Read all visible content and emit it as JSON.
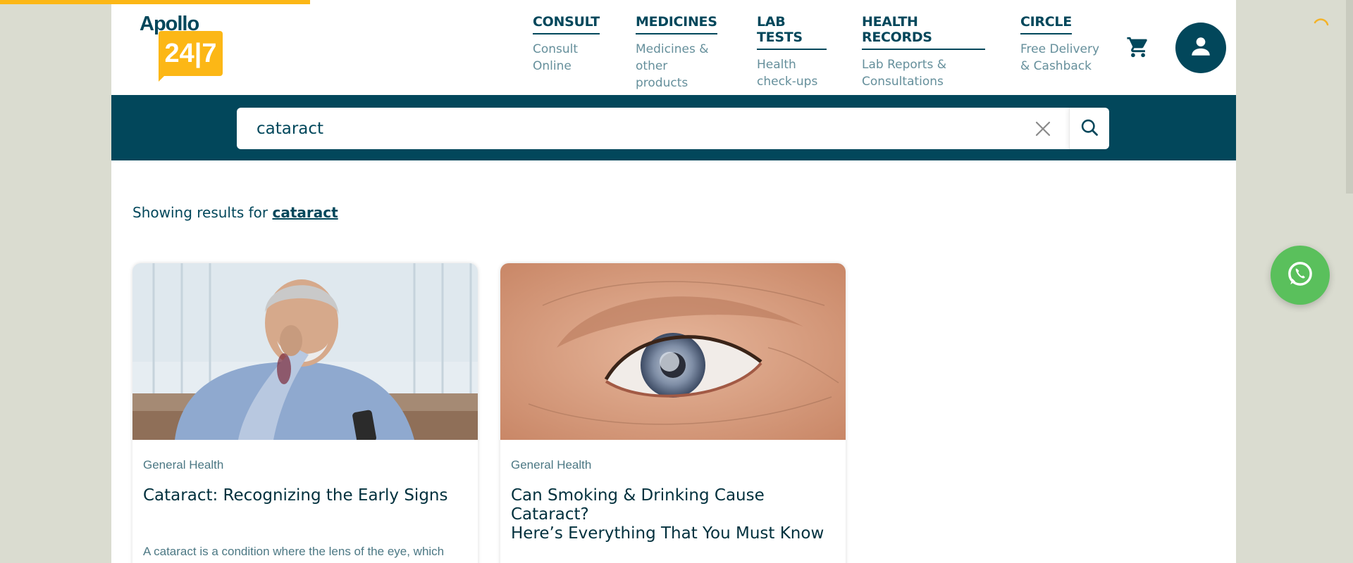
{
  "logo": {
    "brand": "Apollo",
    "number": "24|7"
  },
  "nav": [
    {
      "title": "CONSULT",
      "sub1": "Consult",
      "sub2": "Online"
    },
    {
      "title": "MEDICINES",
      "sub1": "Medicines &",
      "sub2": "other products"
    },
    {
      "title": "LAB TESTS",
      "sub1": "Health",
      "sub2": "check-ups"
    },
    {
      "title": "HEALTH RECORDS",
      "sub1": "Lab Reports &",
      "sub2": "Consultations"
    },
    {
      "title": "CIRCLE",
      "sub1": "Free Delivery",
      "sub2": "& Cashback"
    }
  ],
  "icons": {
    "cart": "cart-icon",
    "user": "user-icon",
    "clear": "close-icon",
    "search": "search-icon",
    "whatsapp": "whatsapp-icon",
    "loading": "spinner-icon"
  },
  "search": {
    "value": "cataract"
  },
  "results": {
    "prefix": "Showing results for ",
    "term": "cataract"
  },
  "cards": [
    {
      "image": "elderly man rubbing eye holding glasses",
      "category": "General Health",
      "title": "Cataract: Recognizing the Early Signs",
      "description": "A cataract is a condition where the lens of the eye, which"
    },
    {
      "image": "close-up of an eye with cloudy lens",
      "category": "General Health",
      "title_line1": "Can Smoking & Drinking Cause Cataract?",
      "title_line2": "Here’s Everything That You Must Know"
    }
  ],
  "colors": {
    "brand": "#02475b",
    "accent": "#fcb716",
    "whatsapp": "#5ac05c",
    "background": "#dadcd0"
  }
}
